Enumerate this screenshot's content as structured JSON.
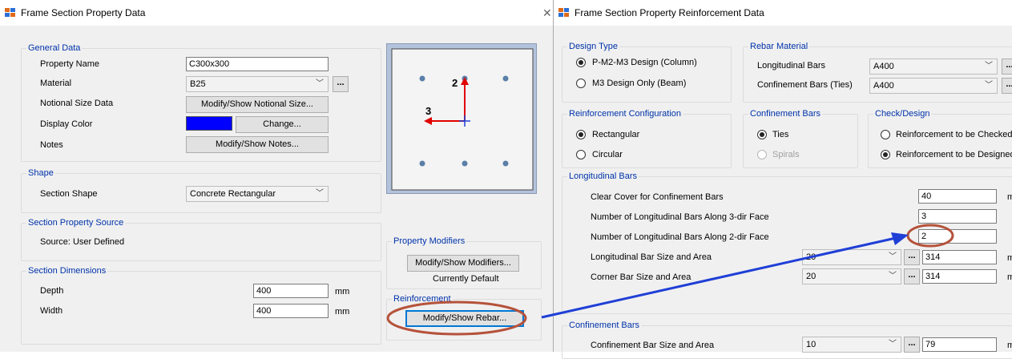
{
  "left_window": {
    "title": "Frame Section Property Data",
    "general_data": {
      "group_label": "General Data",
      "property_name_label": "Property Name",
      "property_name_value": "C300x300",
      "material_label": "Material",
      "material_value": "B25",
      "notional_label": "Notional Size Data",
      "notional_button": "Modify/Show Notional Size...",
      "display_color_label": "Display Color",
      "display_color_value": "#0000ff",
      "change_button": "Change...",
      "notes_label": "Notes",
      "notes_button": "Modify/Show Notes..."
    },
    "shape": {
      "group_label": "Shape",
      "section_shape_label": "Section Shape",
      "section_shape_value": "Concrete Rectangular"
    },
    "source": {
      "group_label": "Section Property Source",
      "source_text": "Source:  User Defined"
    },
    "dimensions": {
      "group_label": "Section Dimensions",
      "depth_label": "Depth",
      "depth_value": "400",
      "depth_unit": "mm",
      "width_label": "Width",
      "width_value": "400",
      "width_unit": "mm"
    },
    "preview": {
      "axis2": "2",
      "axis3": "3"
    },
    "modifiers": {
      "group_label": "Property Modifiers",
      "button": "Modify/Show Modifiers...",
      "status": "Currently Default"
    },
    "reinforcement": {
      "group_label": "Reinforcement",
      "button": "Modify/Show Rebar..."
    }
  },
  "right_window": {
    "title": "Frame Section Property Reinforcement Data",
    "design_type": {
      "group_label": "Design Type",
      "option1": "P-M2-M3 Design  (Column)",
      "option2": "M3 Design Only  (Beam)"
    },
    "rebar_material": {
      "group_label": "Rebar Material",
      "longitudinal_label": "Longitudinal Bars",
      "longitudinal_value": "A400",
      "confinement_label": "Confinement Bars (Ties)",
      "confinement_value": "A400"
    },
    "reinf_config": {
      "group_label": "Reinforcement Configuration",
      "option1": "Rectangular",
      "option2": "Circular"
    },
    "confinement_bars_type": {
      "group_label": "Confinement Bars",
      "option1": "Ties",
      "option2": "Spirals"
    },
    "check_design": {
      "group_label": "Check/Design",
      "option1": "Reinforcement to be Checked",
      "option2": "Reinforcement to be Designed"
    },
    "longitudinal": {
      "group_label": "Longitudinal Bars",
      "clear_cover_label": "Clear Cover for Confinement Bars",
      "clear_cover_value": "40",
      "clear_cover_unit": "m",
      "bars_3dir_label": "Number of Longitudinal Bars Along 3-dir Face",
      "bars_3dir_value": "3",
      "bars_2dir_label": "Number of Longitudinal Bars Along 2-dir Face",
      "bars_2dir_value": "2",
      "bar_size_label": "Longitudinal Bar Size and Area",
      "bar_size_value": "20",
      "bar_area_value": "314",
      "bar_area_unit": "m",
      "corner_label": "Corner Bar Size and Area",
      "corner_size_value": "20",
      "corner_area_value": "314",
      "corner_area_unit": "m"
    },
    "confinement": {
      "group_label": "Confinement Bars",
      "size_label": "Confinement Bar Size and Area",
      "size_value": "10",
      "area_value": "79",
      "area_unit": "m"
    }
  },
  "colors": {
    "window_bg": "#f0f0f0",
    "group_label": "#0033aa",
    "annotation": "#b5523b",
    "arrow": "#1f3fd6"
  }
}
